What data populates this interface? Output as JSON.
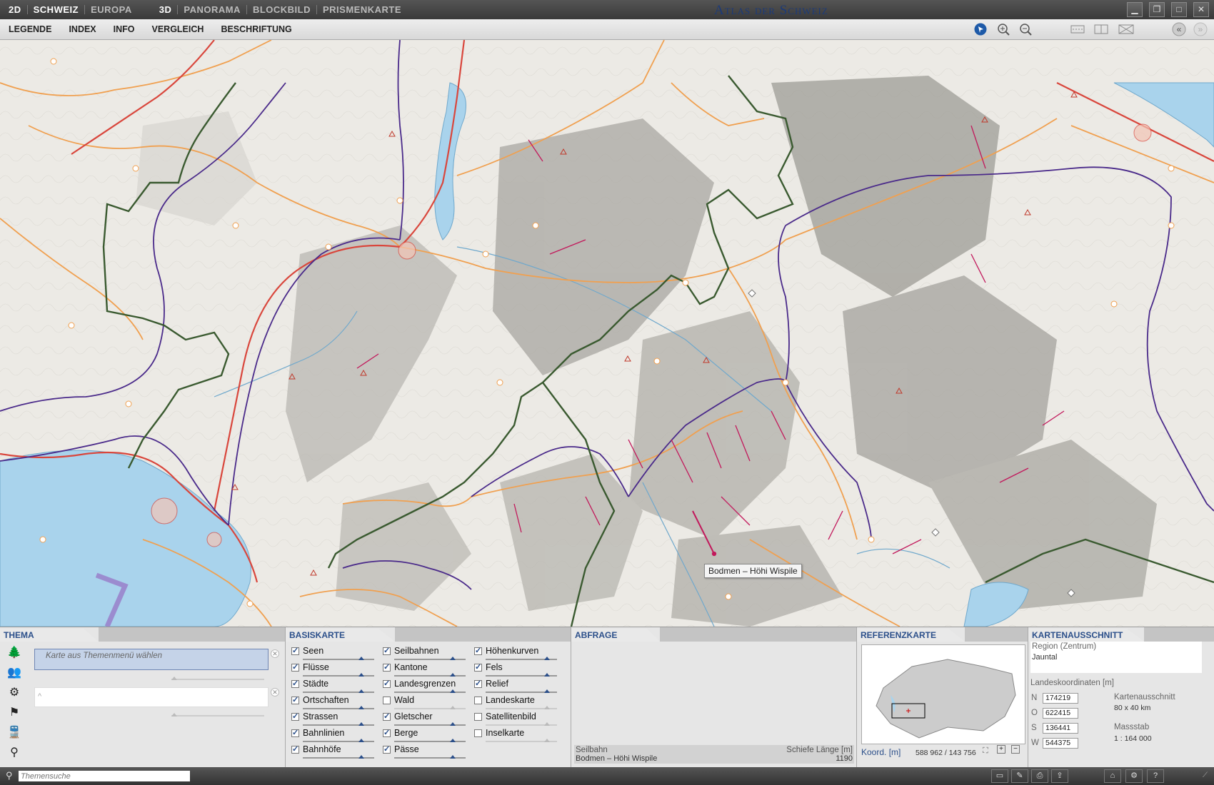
{
  "titlebar": {
    "nav": [
      "2D",
      "SCHWEIZ",
      "EUROPA",
      "3D",
      "PANORAMA",
      "BLOCKBILD",
      "PRISMENKARTE"
    ],
    "active": "SCHWEIZ",
    "app_title": "Atlas der Schweiz"
  },
  "menubar": {
    "items": [
      "LEGENDE",
      "INDEX",
      "INFO",
      "VERGLEICH",
      "BESCHRIFTUNG"
    ]
  },
  "map": {
    "tooltip": "Bodmen – Höhi Wispile",
    "colors": {
      "lake": "#a9d3ec",
      "road_orange": "#f0a050",
      "road_red": "#d9463c",
      "rail_purple": "#4a2a8a",
      "border_green": "#3a5a30",
      "cablecar": "#c2185b"
    }
  },
  "thema": {
    "title": "THEMA",
    "select_placeholder": "Karte aus Themenmenü wählen",
    "search_placeholder": "Themensuche"
  },
  "basiskarte": {
    "title": "BASISKARTE",
    "col1": [
      {
        "label": "Seen",
        "checked": true
      },
      {
        "label": "Flüsse",
        "checked": true
      },
      {
        "label": "Städte",
        "checked": true
      },
      {
        "label": "Ortschaften",
        "checked": true
      },
      {
        "label": "Strassen",
        "checked": true
      },
      {
        "label": "Bahnlinien",
        "checked": true
      },
      {
        "label": "Bahnhöfe",
        "checked": true
      }
    ],
    "col2": [
      {
        "label": "Seilbahnen",
        "checked": true
      },
      {
        "label": "Kantone",
        "checked": true
      },
      {
        "label": "Landesgrenzen",
        "checked": true
      },
      {
        "label": "Wald",
        "checked": false
      },
      {
        "label": "Gletscher",
        "checked": true
      },
      {
        "label": "Berge",
        "checked": true
      },
      {
        "label": "Pässe",
        "checked": true
      }
    ],
    "col3": [
      {
        "label": "Höhenkurven",
        "checked": true
      },
      {
        "label": "Fels",
        "checked": true
      },
      {
        "label": "Relief",
        "checked": true
      },
      {
        "label": "Landeskarte",
        "checked": false
      },
      {
        "label": "Satellitenbild",
        "checked": false
      },
      {
        "label": "Inselkarte",
        "checked": false
      }
    ]
  },
  "abfrage": {
    "title": "ABFRAGE",
    "col_left_header": "Seilbahn",
    "col_right_header": "Schiefe Länge [m]",
    "row_left": "Bodmen – Höhi Wispile",
    "row_right": "1190"
  },
  "referenzkarte": {
    "title": "REFERENZKARTE",
    "coord_label": "Koord. [m]",
    "coord_value": "588 962 / 143 756"
  },
  "kartenausschnitt": {
    "title": "KARTENAUSSCHNITT",
    "region_label": "Region (Zentrum)",
    "region_value": "Jauntal",
    "coords_title": "Landeskoordinaten [m]",
    "N": "174219",
    "O": "622415",
    "S": "136441",
    "W": "544375",
    "ausschnitt_label": "Kartenausschnitt",
    "ausschnitt_value": "80 x 40 km",
    "massstab_label": "Massstab",
    "massstab_value": "1 : 164 000"
  }
}
